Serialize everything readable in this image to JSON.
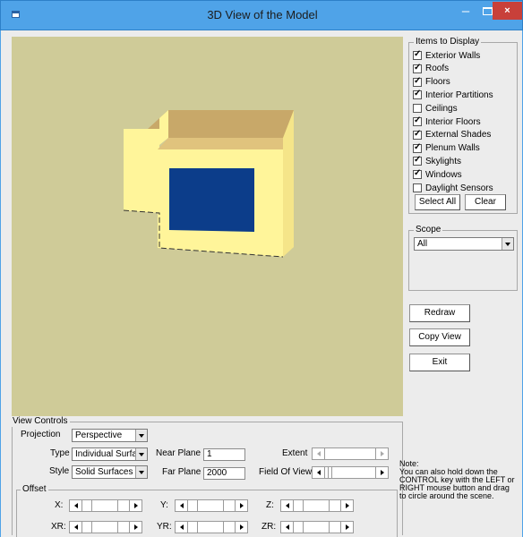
{
  "window": {
    "title": "3D View of the Model",
    "close_label": "×",
    "minimize_label": "–"
  },
  "items_to_display": {
    "legend": "Items to Display",
    "items": [
      {
        "label": "Exterior Walls",
        "checked": true
      },
      {
        "label": "Roofs",
        "checked": true
      },
      {
        "label": "Floors",
        "checked": true
      },
      {
        "label": "Interior Partitions",
        "checked": true
      },
      {
        "label": "Ceilings",
        "checked": false
      },
      {
        "label": "Interior Floors",
        "checked": true
      },
      {
        "label": "External Shades",
        "checked": true
      },
      {
        "label": "Plenum Walls",
        "checked": true
      },
      {
        "label": "Skylights",
        "checked": true
      },
      {
        "label": "Windows",
        "checked": true
      },
      {
        "label": "Daylight Sensors",
        "checked": false
      }
    ],
    "select_all_label": "Select All",
    "clear_label": "Clear"
  },
  "scope": {
    "legend": "Scope",
    "value": "All"
  },
  "actions": {
    "redraw_label": "Redraw",
    "copy_view_label": "Copy View",
    "exit_label": "Exit"
  },
  "view_controls": {
    "legend": "View Controls",
    "projection_label": "Projection",
    "projection_value": "Perspective",
    "type_label": "Type",
    "type_value": "Individual Surfac",
    "style_label": "Style",
    "style_value": "Solid Surfaces",
    "near_plane_label": "Near Plane",
    "near_plane_value": "1",
    "far_plane_label": "Far Plane",
    "far_plane_value": "2000",
    "extent_label": "Extent",
    "fov_label": "Field Of View",
    "offset_legend": "Offset",
    "x_label": "X:",
    "y_label": "Y:",
    "z_label": "Z:",
    "xr_label": "XR:",
    "yr_label": "YR:",
    "zr_label": "ZR:",
    "note": "Note:\nYou can also hold down the CONTROL key with the LEFT or RIGHT mouse button and drag to circle around the scene."
  },
  "colors": {
    "viewport_bg": "#cfcb98",
    "wall_front": "#fff59a",
    "wall_side": "#f3e07e",
    "roof": "#c8a869",
    "window": "#0c3d8a",
    "titlebar": "#4fa3e8"
  }
}
